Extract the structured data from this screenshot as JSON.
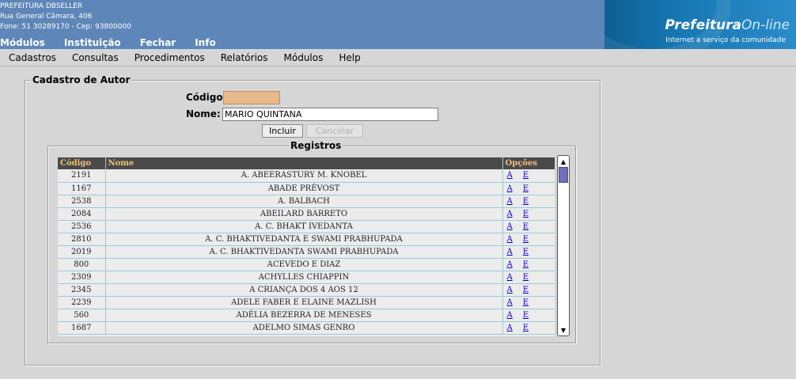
{
  "header": {
    "org_name": "PREFEITURA DBSELLER",
    "address": "Rua General Câmara, 406",
    "contact": "Fone: 51 30289170  -  Cep: 93800000",
    "top_menu": [
      "Módulos",
      "Instituição",
      "Fechar",
      "Info"
    ],
    "logo_title_a": "Prefeitura",
    "logo_title_b": "On-line",
    "logo_subtitle": "Internet a serviço da comunidade"
  },
  "app_menu": [
    "Cadastros",
    "Consultas",
    "Procedimentos",
    "Relatórios",
    "Módulos",
    "Help"
  ],
  "form": {
    "legend": "Cadastro de Autor",
    "codigo_label": "Código:",
    "codigo_value": "",
    "nome_label": "Nome:",
    "nome_value": "MARIO QUINTANA",
    "incluir_label": "Incluir",
    "cancelar_label": "Cancelar"
  },
  "registros": {
    "legend": "Registros",
    "columns": [
      "Código",
      "Nome",
      "Opções"
    ],
    "option_links": [
      "A",
      "E"
    ],
    "rows": [
      {
        "codigo": "2191",
        "nome": "A. ABEERASTURY M. KNOBEL"
      },
      {
        "codigo": "1167",
        "nome": "ABADE PRÉVOST"
      },
      {
        "codigo": "2538",
        "nome": "A. BALBACH"
      },
      {
        "codigo": "2084",
        "nome": "ABEILARD BARRETO"
      },
      {
        "codigo": "2536",
        "nome": "A. C. BHAKT IVEDANTA"
      },
      {
        "codigo": "2810",
        "nome": "A. C. BHAKTIVEDANTA E SWAMI PRABHUPADA"
      },
      {
        "codigo": "2019",
        "nome": "A. C. BHAKTIVEDANTA SWAMI PRABHUPADA"
      },
      {
        "codigo": "800",
        "nome": "ACEVEDO E DIAZ"
      },
      {
        "codigo": "2309",
        "nome": "ACHYLLES CHIAPPIN"
      },
      {
        "codigo": "2345",
        "nome": "A CRIANÇA DOS 4 AOS 12"
      },
      {
        "codigo": "2239",
        "nome": "ADELE FABER E ELAINE MAZLISH"
      },
      {
        "codigo": "560",
        "nome": "ADÉLIA BEZERRA DE MENESES"
      },
      {
        "codigo": "1687",
        "nome": "ADELMO SIMAS GENRO"
      }
    ]
  },
  "colors": {
    "header_bg": "#5e86b8",
    "codigo_field_bg": "#e8b98b",
    "table_header_bg": "#4a4a4a",
    "table_header_text": "#f2c27a",
    "link": "#0000cc"
  },
  "icons": {
    "scroll_up": "arrow-up-icon",
    "scroll_down": "arrow-down-icon"
  }
}
